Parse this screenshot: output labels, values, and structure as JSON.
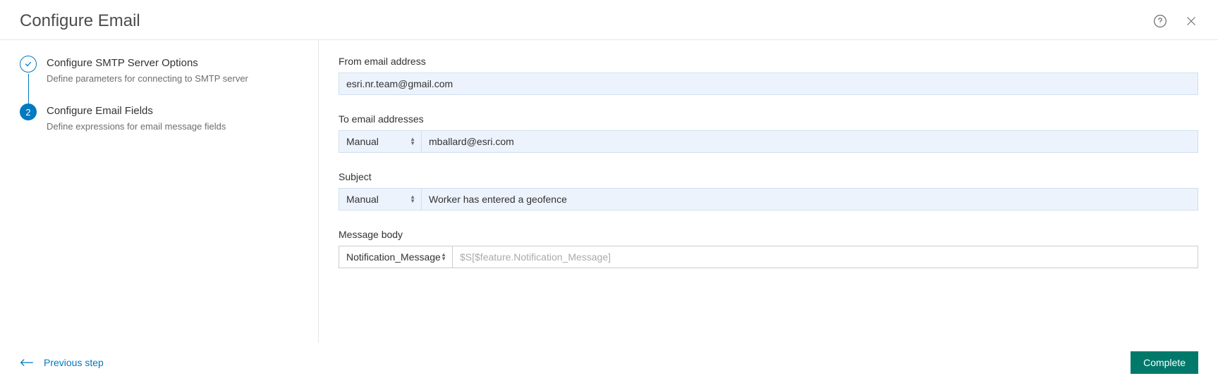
{
  "header": {
    "title": "Configure Email"
  },
  "steps": {
    "step1": {
      "title": "Configure SMTP Server Options",
      "desc": "Define parameters for connecting to SMTP server"
    },
    "step2": {
      "number": "2",
      "title": "Configure Email Fields",
      "desc": "Define expressions for email message fields"
    }
  },
  "fields": {
    "from": {
      "label": "From email address",
      "value": "esri.nr.team@gmail.com"
    },
    "to": {
      "label": "To email addresses",
      "mode": "Manual",
      "value": "mballard@esri.com"
    },
    "subject": {
      "label": "Subject",
      "mode": "Manual",
      "value": "Worker has entered a geofence"
    },
    "body": {
      "label": "Message body",
      "mode": "Notification_Message",
      "placeholder": "$S[$feature.Notification_Message]"
    }
  },
  "footer": {
    "prev": "Previous step",
    "complete": "Complete"
  },
  "icons": {
    "help": "help-icon",
    "close": "close-icon",
    "check": "check-icon",
    "arrowLeft": "arrow-left-icon"
  }
}
